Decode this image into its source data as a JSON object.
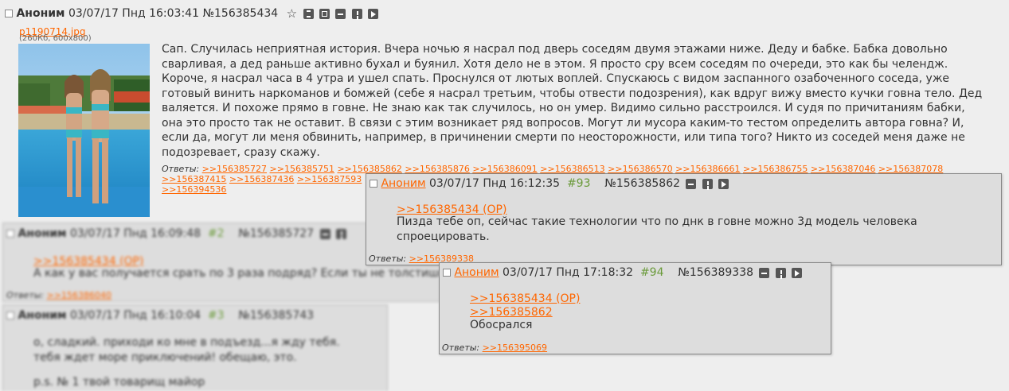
{
  "op": {
    "name": "Аноним",
    "datetime": "03/07/17 Пнд 16:03:41",
    "number": "№156385434",
    "file_name": "p1190714.jpg",
    "file_meta": "(260Кб, 600x800)",
    "body": "Сап. Случилась неприятная история. Вчера ночью я насрал под дверь соседям двумя этажами ниже. Деду и бабке. Бабка довольно сварливая, а дед раньше активно бухал и буянил. Хотя дело не в этом. Я просто сру всем соседям по очереди, это как бы челендж. Короче, я насрал часа в 4 утра и ушел спать. Проснулся от лютых воплей. Спускаюсь с видом заспанного озабоченного соседа, уже готовый винить наркоманов и бомжей (себе я насрал третьим, чтобы отвести подозрения), как вдруг вижу вместо кучки говна тело. Дед валяется. И похоже прямо в говне. Не знаю как так случилось, но он умер. Видимо сильно расстроился. И судя по причитаниям бабки, она это просто так не оставит. В связи с этим возникает ряд вопросов. Могут ли мусора каким-то тестом определить автора говна? И, если да, могут ли меня обвинить, например, в причинении смерти по неосторожности, или типа того? Никто из соседей меня даже не подозревает, сразу скажу.",
    "replies_label": "Ответы:",
    "replies": [
      ">>156385727",
      ">>156385751",
      ">>156385862",
      ">>156385876",
      ">>156386091",
      ">>156386513",
      ">>156386570",
      ">>156386661",
      ">>156386755",
      ">>156387046",
      ">>156387078",
      ">>156387415",
      ">>156387436",
      ">>156387593",
      ">>156394536"
    ]
  },
  "post2": {
    "name": "Аноним",
    "datetime": "03/07/17 Пнд 16:09:48",
    "index": "#2",
    "number": "№156385727",
    "quote": ">>156385434 (OP)",
    "body": "А как у вас получается срать по 3 раза подряд? Если ты не толстишь",
    "replies_label": "Ответы:",
    "reply": ">>156386040"
  },
  "post3": {
    "name": "Аноним",
    "datetime": "03/07/17 Пнд 16:10:04",
    "index": "#3",
    "number": "№156385743",
    "body1": "о, сладкий. приходи ко мне в подъезд...я жду тебя. тебя ждет море приключений! обещаю, это.",
    "body2": "p.s. № 1 твой товарищ майор"
  },
  "popup1": {
    "name": "Аноним",
    "datetime": "03/07/17 Пнд 16:12:35",
    "index": "#93",
    "number": "№156385862",
    "quote": ">>156385434 (OP)",
    "body": "Пизда тебе оп, сейчас такие технологии что по днк в говне можно 3д модель человека спроецировать.",
    "replies_label": "Ответы:",
    "reply": ">>156389338"
  },
  "popup2": {
    "name": "Аноним",
    "datetime": "03/07/17 Пнд 17:18:32",
    "index": "#94",
    "number": "№156389338",
    "quote1": ">>156385434 (OP)",
    "quote2": ">>156385862",
    "body": "Обосрался",
    "replies_label": "Ответы:",
    "reply": ">>156395069"
  },
  "icons": [
    "star-icon",
    "sort-icon",
    "window-icon",
    "hide-icon",
    "report-icon",
    "play-icon"
  ],
  "colors": {
    "link": "#ff6600",
    "post_number": "#6a9a3a",
    "post_bg": "#dddddd",
    "page_bg": "#eeeeee"
  }
}
